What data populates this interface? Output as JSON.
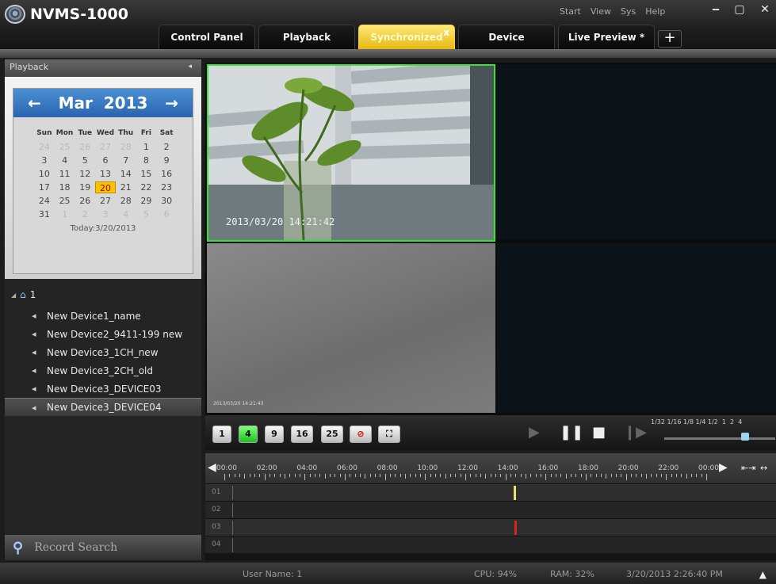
{
  "app": {
    "title": "NVMS-1000"
  },
  "menu": [
    "Start",
    "View",
    "Sys",
    "Help"
  ],
  "window_controls": {
    "minimize": "‒",
    "maximize": "▢",
    "close": "✕"
  },
  "tabs": [
    {
      "label": "Control Panel"
    },
    {
      "label": "Playback"
    },
    {
      "label": "Synchronized",
      "close": "x"
    },
    {
      "label": "Device"
    },
    {
      "label": "Live Preview *"
    }
  ],
  "add_tab_label": "+",
  "panel": {
    "title": "Playback",
    "collapse_arrow": "◂"
  },
  "calendar": {
    "month": "Mar",
    "year": "2013",
    "prev": "←",
    "next": "→",
    "weekdays": [
      "Sun",
      "Mon",
      "Tue",
      "Wed",
      "Thu",
      "Fri",
      "Sat"
    ],
    "days": [
      [
        "24",
        "25",
        "26",
        "27",
        "28",
        "1",
        "2"
      ],
      [
        "3",
        "4",
        "5",
        "6",
        "7",
        "8",
        "9"
      ],
      [
        "10",
        "11",
        "12",
        "13",
        "14",
        "15",
        "16"
      ],
      [
        "17",
        "18",
        "19",
        "20",
        "21",
        "22",
        "23"
      ],
      [
        "24",
        "25",
        "26",
        "27",
        "28",
        "29",
        "30"
      ],
      [
        "31",
        "1",
        "2",
        "3",
        "4",
        "5",
        "6"
      ]
    ],
    "selected_day": "20",
    "today_label": "Today:3/20/2013"
  },
  "tree": {
    "root": "1",
    "devices": [
      "New Device1_name",
      "New Device2_9411-199 new",
      "New Device3_1CH_new",
      "New Device3_2CH_old",
      "New Device3_DEVICE03",
      "New Device3_DEVICE04"
    ],
    "selected_index": 5
  },
  "record_search": "Record Search",
  "video": {
    "osd_main": "2013/03/20 14:21:42",
    "osd_small": "2013/03/20 14:21:43"
  },
  "layout_buttons": [
    "1",
    "4",
    "9",
    "16",
    "25"
  ],
  "active_layout": "4",
  "speeds": [
    "1/32",
    "1/16",
    "1/8",
    "1/4",
    "1/2",
    "1",
    "2",
    "4"
  ],
  "timeline": {
    "hours": [
      "00:00",
      "02:00",
      "04:00",
      "06:00",
      "08:00",
      "10:00",
      "12:00",
      "14:00",
      "16:00",
      "18:00",
      "20:00",
      "22:00",
      "00:00"
    ],
    "tracks": [
      "01",
      "02",
      "03",
      "04"
    ],
    "playhead_color": "#e8e070",
    "marker_color": "#e0201a"
  },
  "status": {
    "user": "User Name: 1",
    "cpu": "CPU: 94%",
    "ram": "RAM: 32%",
    "datetime": "3/20/2013 2:26:40 PM"
  },
  "colors": {
    "active_tab": "#f5c518",
    "selected_cell_border": "#2ee82e",
    "calendar_header": "#2f6fbf"
  }
}
